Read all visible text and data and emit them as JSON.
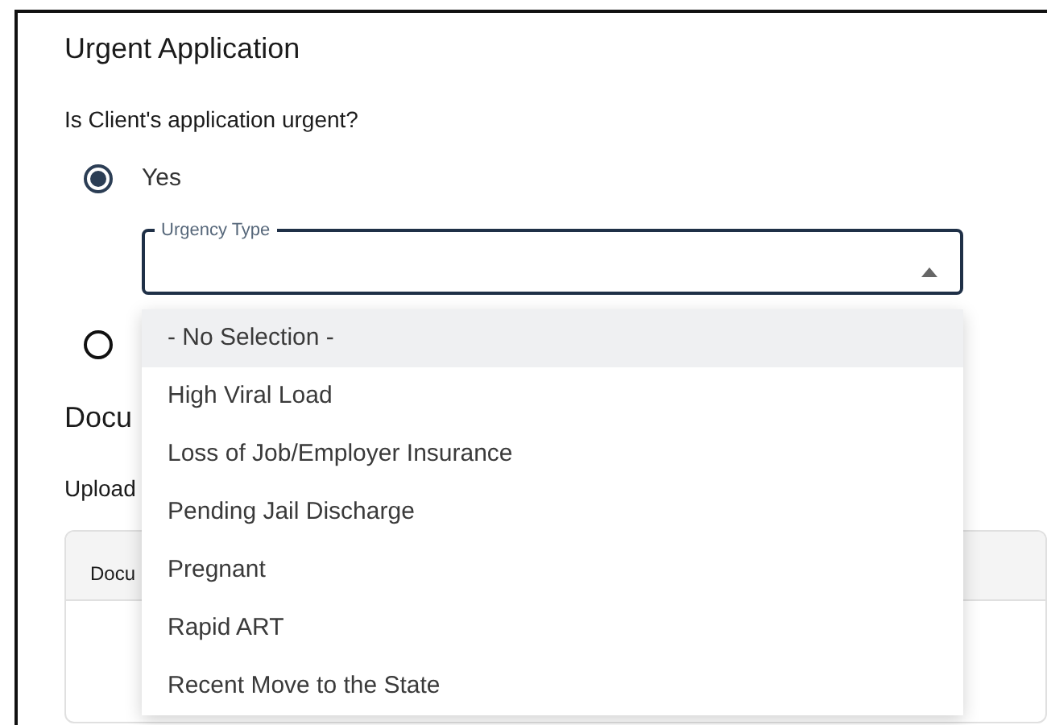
{
  "section": {
    "title": "Urgent Application",
    "question": "Is Client's application urgent?"
  },
  "radios": [
    {
      "label": "Yes",
      "selected": true
    },
    {
      "selected": false
    }
  ],
  "select": {
    "label": "Urgency Type",
    "expanded": true
  },
  "menu": [
    {
      "label": "- No Selection -",
      "highlighted": true
    },
    {
      "label": "High Viral Load",
      "highlighted": false
    },
    {
      "label": "Loss of Job/Employer Insurance",
      "highlighted": false
    },
    {
      "label": "Pending Jail Discharge",
      "highlighted": false
    },
    {
      "label": "Pregnant",
      "highlighted": false
    },
    {
      "label": "Rapid ART",
      "highlighted": false
    },
    {
      "label": "Recent Move to the State",
      "highlighted": false
    }
  ],
  "documents": {
    "title": "Docu",
    "text": "Upload",
    "table": {
      "columns": [
        "Docu"
      ]
    }
  }
}
